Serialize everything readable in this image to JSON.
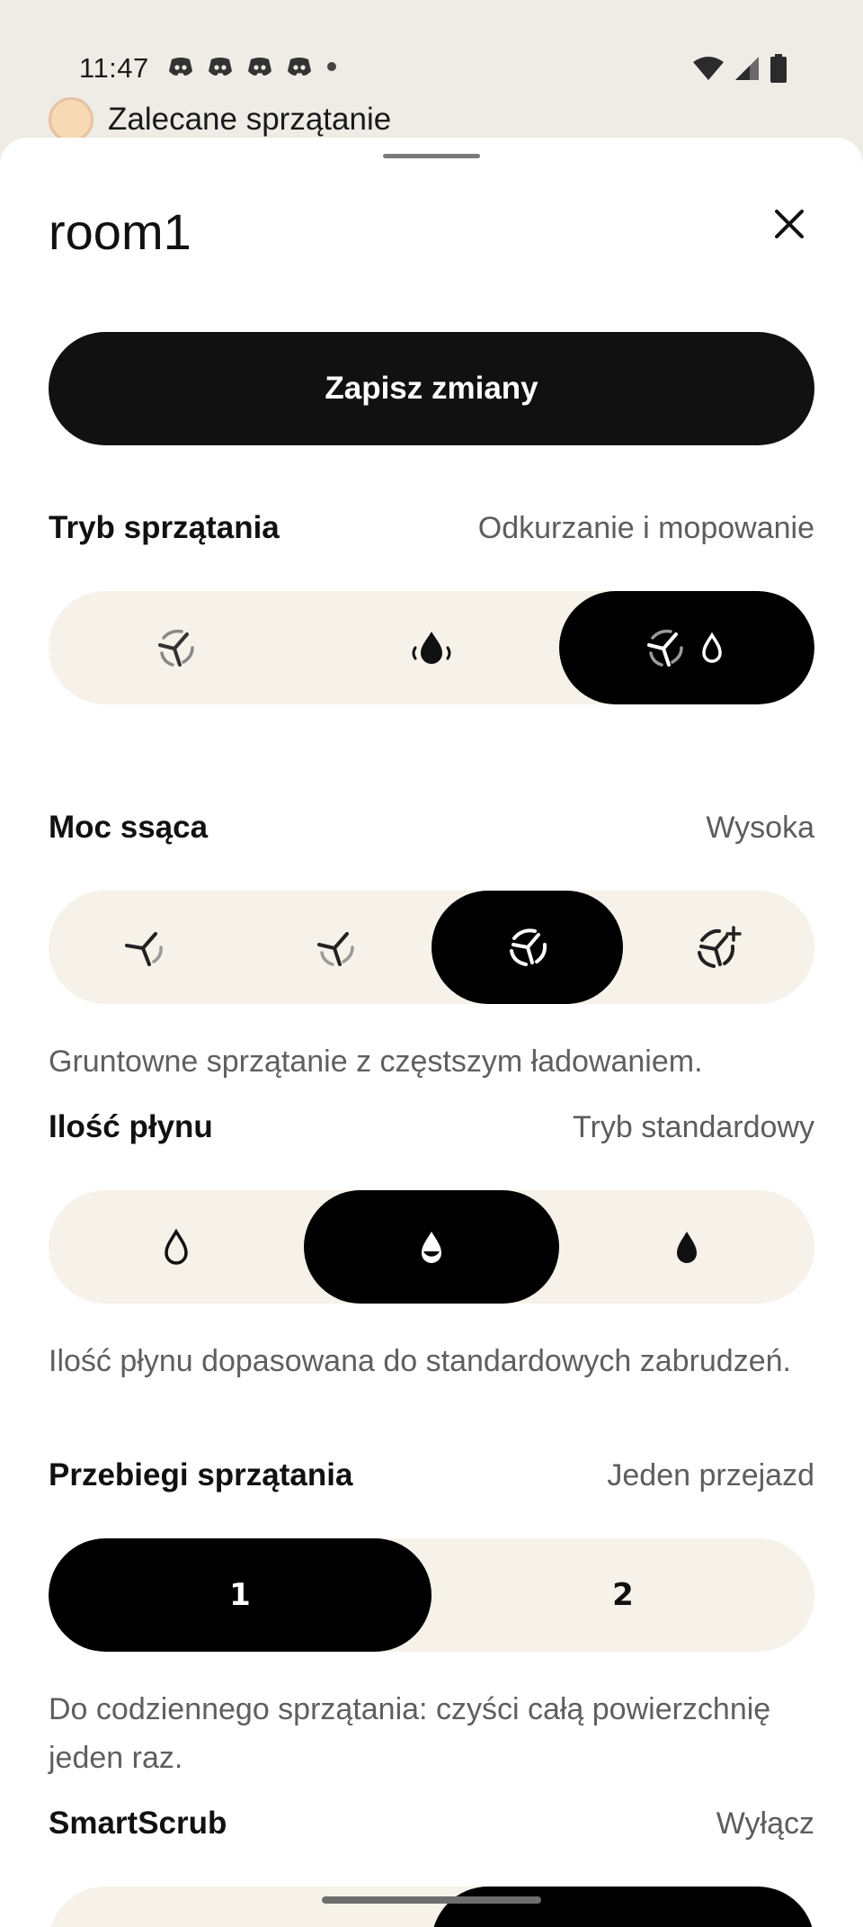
{
  "status_bar": {
    "time": "11:47",
    "notification_icons": [
      "discord-icon",
      "discord-icon",
      "discord-icon",
      "discord-icon",
      "dot-icon"
    ],
    "system_icons": [
      "wifi-icon",
      "signal-icon",
      "battery-icon"
    ]
  },
  "behind": {
    "label": "Zalecane sprzątanie"
  },
  "sheet": {
    "title": "room1",
    "save_label": "Zapisz zmiany"
  },
  "cleaning_mode": {
    "label": "Tryb sprzątania",
    "value": "Odkurzanie i mopowanie",
    "options": [
      "vacuum-icon",
      "mop-icon",
      "vacuum-mop-icon"
    ],
    "selected_index": 2
  },
  "suction": {
    "label": "Moc ssąca",
    "value": "Wysoka",
    "options": [
      "fan-low-icon",
      "fan-medium-icon",
      "fan-high-icon",
      "fan-max-icon"
    ],
    "selected_index": 2,
    "description": "Gruntowne sprzątanie z częstszym ładowaniem."
  },
  "water": {
    "label": "Ilość płynu",
    "value": "Tryb standardowy",
    "options": [
      "drop-low-icon",
      "drop-medium-icon",
      "drop-high-icon"
    ],
    "selected_index": 1,
    "description": "Ilość płynu dopasowana do standardowych zabrudzeń."
  },
  "passes": {
    "label": "Przebiegi sprzątania",
    "value": "Jeden przejazd",
    "options": [
      "1",
      "2"
    ],
    "selected_index": 0,
    "description": "Do codziennego sprzątania: czyści całą powierzchnię jeden raz."
  },
  "smartscrub": {
    "label": "SmartScrub",
    "value": "Wyłącz"
  },
  "colors": {
    "accent": "#000000",
    "segment_bg": "#f6f2ea",
    "background": "#efece6"
  }
}
